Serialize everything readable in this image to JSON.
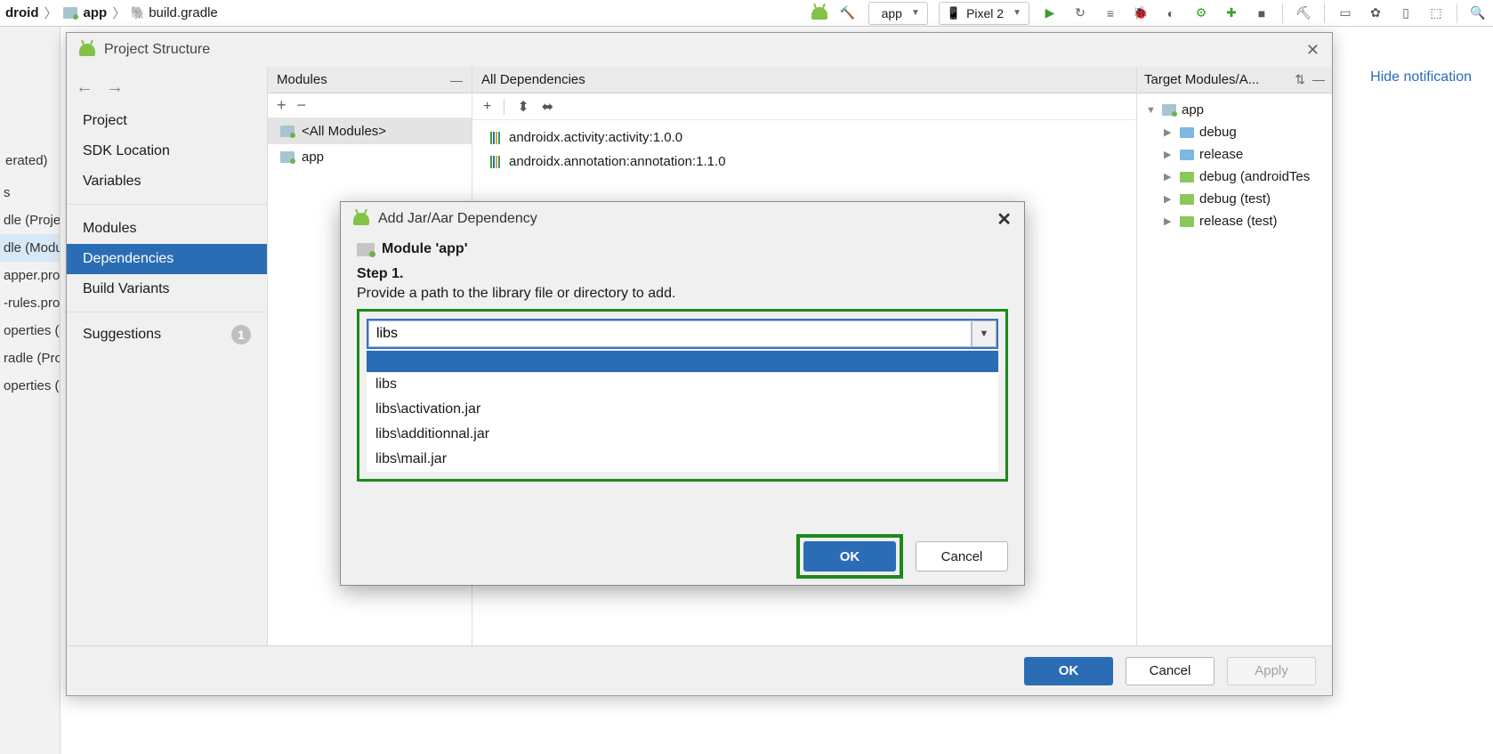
{
  "breadcrumbs": {
    "root": "droid",
    "app": "app",
    "file": "build.gradle"
  },
  "config_selector": "app",
  "device_selector": "Pixel 2",
  "hide_notification": "Hide notification",
  "left_strip": {
    "erated": "erated)",
    "items": [
      "s",
      "dle (Proje",
      "dle (Modu",
      "apper.pro",
      "-rules.pro",
      "operties (",
      "radle (Pro",
      "operties (S"
    ],
    "selected_index": 2
  },
  "ps": {
    "title": "Project Structure",
    "nav": {
      "group1": [
        "Project",
        "SDK Location",
        "Variables"
      ],
      "group2": [
        "Modules",
        "Dependencies",
        "Build Variants"
      ],
      "suggestions": "Suggestions",
      "suggestions_count": "1",
      "selected": "Dependencies"
    },
    "modules": {
      "header": "Modules",
      "items": [
        "<All Modules>",
        "app"
      ],
      "selected_index": 0
    },
    "deps": {
      "header": "All Dependencies",
      "items": [
        "androidx.activity:activity:1.0.0",
        "androidx.annotation:annotation:1.1.0"
      ]
    },
    "targets": {
      "header": "Target Modules/A...",
      "root": "app",
      "children": [
        "debug",
        "release",
        "debug (androidTes",
        "debug (test)",
        "release (test)"
      ]
    },
    "buttons": {
      "ok": "OK",
      "cancel": "Cancel",
      "apply": "Apply"
    }
  },
  "jar": {
    "title": "Add Jar/Aar Dependency",
    "module_label": "Module 'app'",
    "step_title": "Step 1.",
    "step_desc": "Provide a path to the library file or directory to add.",
    "input_value": "libs",
    "suggestions": [
      "",
      "libs",
      "libs\\activation.jar",
      "libs\\additionnal.jar",
      "libs\\mail.jar"
    ],
    "ok": "OK",
    "cancel": "Cancel"
  }
}
